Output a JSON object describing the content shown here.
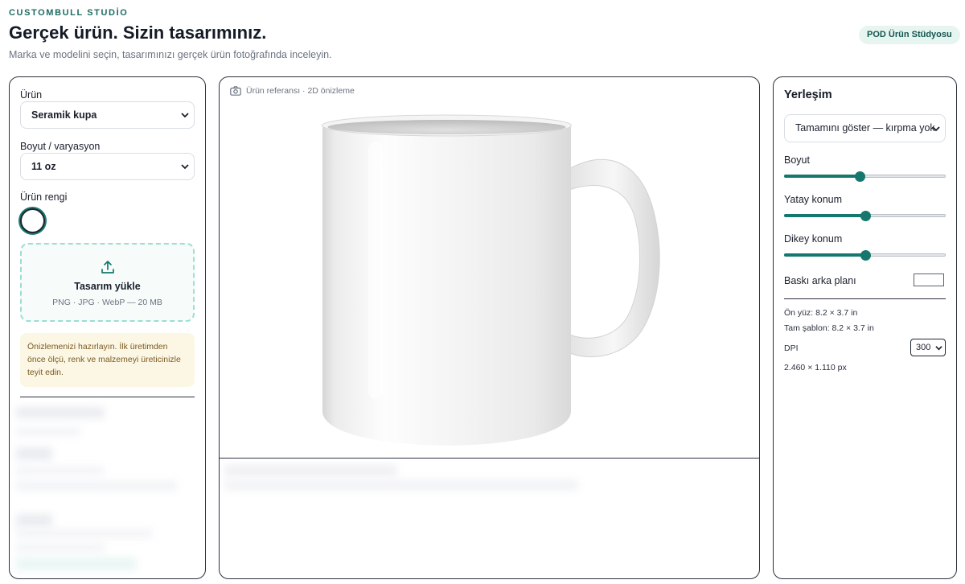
{
  "header": {
    "brand": "CUSTOMBULL STUDİO",
    "title": "Gerçek ürün. Sizin tasarımınız.",
    "subtitle": "Marka ve modelini seçin, tasarımınızı gerçek ürün fotoğrafında inceleyin.",
    "badge": "POD Ürün Stüdyosu"
  },
  "left": {
    "product_label": "Ürün",
    "product_value": "Seramik kupa",
    "size_label": "Boyut / varyasyon",
    "size_value": "11 oz",
    "color_label": "Ürün rengi",
    "selected_color": "#ffffff",
    "upload": {
      "title": "Tasarım yükle",
      "hint": "PNG · JPG · WebP — 20 MB"
    },
    "notice": "Önizlemenizi hazırlayın. İlk üretimden önce ölçü, renk ve malzemeyi üreticinizle teyit edin."
  },
  "center": {
    "header": "Ürün referansı · 2D önizleme",
    "product_image": "white-ceramic-mug"
  },
  "right": {
    "title": "Yerleşim",
    "fit_value": "Tamamını göster — kırpma yok",
    "size_label": "Boyut",
    "size_level": 0.47,
    "h_label": "Yatay konum",
    "h_level": 0.5,
    "v_label": "Dikey konum",
    "v_level": 0.5,
    "print_bg_label": "Baskı arka planı",
    "front_info": "Ön yüz: 8.2 × 3.7 in",
    "template_info": "Tam şablon: 8.2 × 3.7 in",
    "dpi_label": "DPI",
    "dpi_value": "300",
    "px_info": "2.460 × 1.110 px"
  },
  "colors": {
    "accent": "#15776d",
    "badge_bg": "#e7f5f1",
    "notice_bg": "#fcf7e4"
  }
}
